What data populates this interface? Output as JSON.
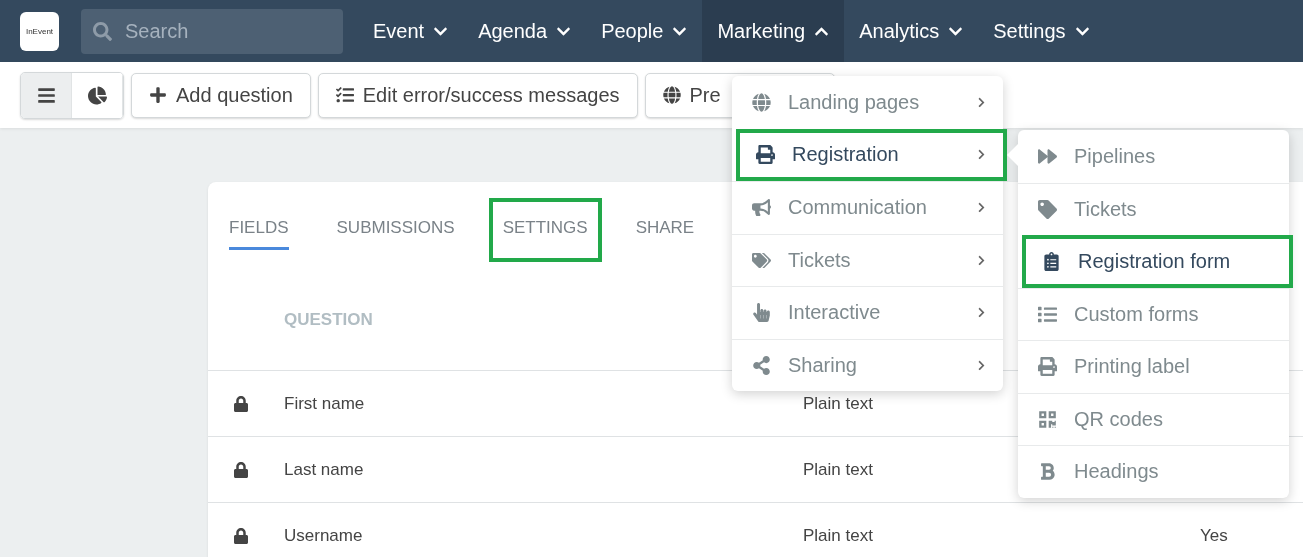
{
  "logo": {
    "text": "InEvent"
  },
  "search": {
    "placeholder": "Search"
  },
  "nav": [
    {
      "label": "Event",
      "selected": false
    },
    {
      "label": "Agenda",
      "selected": false
    },
    {
      "label": "People",
      "selected": false
    },
    {
      "label": "Marketing",
      "selected": true
    },
    {
      "label": "Analytics",
      "selected": false
    },
    {
      "label": "Settings",
      "selected": false
    }
  ],
  "view_toggle": [
    {
      "kind": "list",
      "selected": true
    },
    {
      "kind": "chart",
      "selected": false
    }
  ],
  "toolbar_buttons": [
    {
      "kind": "add",
      "label": "Add question"
    },
    {
      "kind": "messages",
      "label": "Edit error/success messages"
    },
    {
      "kind": "preview",
      "label": "Pre"
    }
  ],
  "tabs": [
    {
      "label": "FIELDS",
      "selected": true,
      "highlighted": false
    },
    {
      "label": "SUBMISSIONS",
      "selected": false,
      "highlighted": false
    },
    {
      "label": "SETTINGS",
      "selected": false,
      "highlighted": true
    },
    {
      "label": "SHARE",
      "selected": false,
      "highlighted": false
    }
  ],
  "table": {
    "columns": [
      "QUESTION"
    ],
    "rows": [
      {
        "locked": true,
        "question": "First name",
        "type": "Plain text"
      },
      {
        "locked": true,
        "question": "Last name",
        "type": "Plain text"
      },
      {
        "locked": true,
        "question": "Username",
        "type": "Plain text",
        "column_3": "Yes"
      }
    ]
  },
  "marketing_menu": [
    {
      "kind": "globe",
      "label": "Landing pages",
      "selected": false,
      "highlighted": false
    },
    {
      "kind": "printer",
      "label": "Registration",
      "selected": true,
      "highlighted": true
    },
    {
      "kind": "megaphone",
      "label": "Communication",
      "selected": false,
      "highlighted": false
    },
    {
      "kind": "tags",
      "label": "Tickets",
      "selected": false,
      "highlighted": false
    },
    {
      "kind": "hand",
      "label": "Interactive",
      "selected": false,
      "highlighted": false
    },
    {
      "kind": "share",
      "label": "Sharing",
      "selected": false,
      "highlighted": false
    }
  ],
  "registration_menu": [
    {
      "kind": "forward",
      "label": "Pipelines",
      "selected": false,
      "highlighted": false
    },
    {
      "kind": "tag",
      "label": "Tickets",
      "selected": false,
      "highlighted": false
    },
    {
      "kind": "clipboard",
      "label": "Registration form",
      "selected": true,
      "highlighted": true
    },
    {
      "kind": "list",
      "label": "Custom forms",
      "selected": false,
      "highlighted": false
    },
    {
      "kind": "printer",
      "label": "Printing label",
      "selected": false,
      "highlighted": false
    },
    {
      "kind": "qrcode",
      "label": "QR codes",
      "selected": false,
      "highlighted": false
    },
    {
      "kind": "bold",
      "label": "Headings",
      "selected": false,
      "highlighted": false
    }
  ]
}
